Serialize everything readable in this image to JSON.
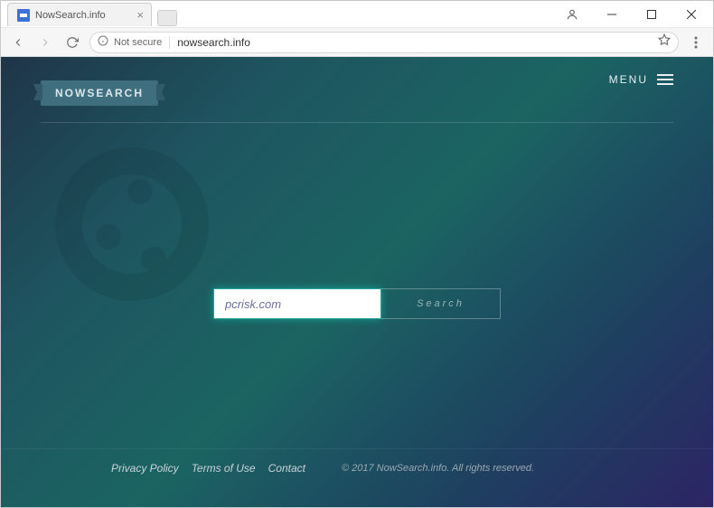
{
  "browser": {
    "tab_title": "NowSearch.info",
    "security_label": "Not secure",
    "url": "nowsearch.info"
  },
  "page": {
    "logo_text": "NOWSEARCH",
    "menu_label": "MENU",
    "search_value": "pcrisk.com",
    "search_button_label": "Search"
  },
  "footer": {
    "links": [
      "Privacy Policy",
      "Terms of Use",
      "Contact"
    ],
    "copyright": "© 2017 NowSearch.info. All rights reserved."
  }
}
